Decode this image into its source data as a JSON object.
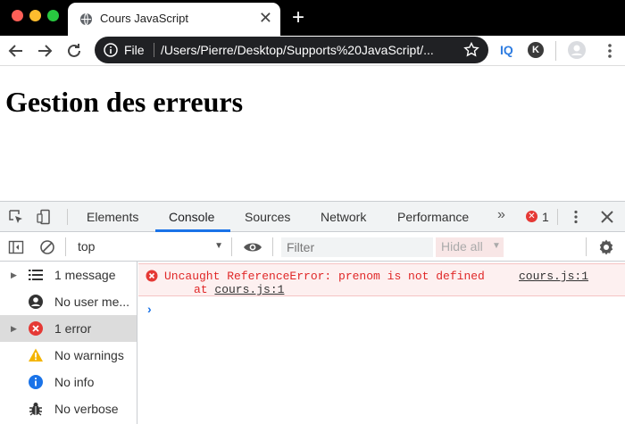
{
  "browser": {
    "tab_title": "Cours JavaScript",
    "new_tab_label": "+",
    "close_tab_label": "✕",
    "address": {
      "scheme_label": "File",
      "url": "/Users/Pierre/Desktop/Supports%20JavaScript/..."
    },
    "extensions": {
      "iq_label": "IQ",
      "k_label": "K"
    }
  },
  "page": {
    "heading": "Gestion des erreurs"
  },
  "devtools": {
    "tabs": [
      "Elements",
      "Console",
      "Sources",
      "Network",
      "Performance"
    ],
    "active_tab": "Console",
    "more_label": "»",
    "error_badge": "✕",
    "error_count": "1",
    "context_select": "top",
    "context_arrow": "▼",
    "filter_placeholder": "Filter",
    "levels_label": "Hide all",
    "levels_arrow": "▼",
    "sidebar": [
      {
        "label": "1 message",
        "icon": "list-icon",
        "expandable": true
      },
      {
        "label": "No user me...",
        "icon": "user-icon",
        "expandable": false
      },
      {
        "label": "1 error",
        "icon": "error-icon",
        "expandable": true,
        "selected": true
      },
      {
        "label": "No warnings",
        "icon": "warning-icon",
        "expandable": false
      },
      {
        "label": "No info",
        "icon": "info-icon",
        "expandable": false
      },
      {
        "label": "No verbose",
        "icon": "bug-icon",
        "expandable": false
      }
    ],
    "console": {
      "error_message": "Uncaught ReferenceError: prenom is not defined",
      "error_source": "cours.js:1",
      "stack_prefix": "at ",
      "stack_link": "cours.js:1",
      "prompt": "›"
    }
  },
  "colors": {
    "accent": "#1a73e8",
    "error": "#e02828",
    "error_bg": "#fdf0f0",
    "omnibox_bg": "#202124"
  }
}
